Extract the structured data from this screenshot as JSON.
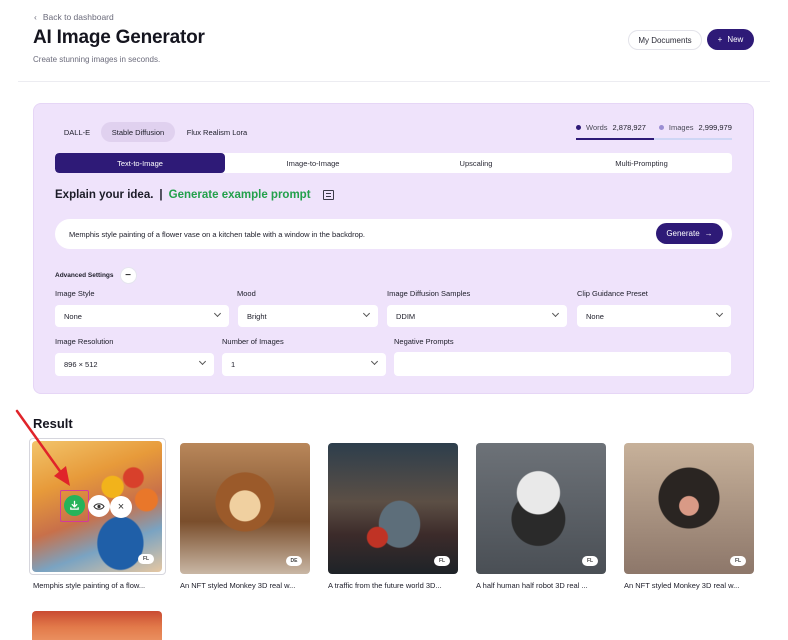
{
  "header": {
    "back_label": "Back to dashboard",
    "title": "AI Image Generator",
    "subtitle": "Create stunning images in seconds.",
    "my_documents_label": "My Documents",
    "new_label": "New"
  },
  "models": [
    "DALL-E",
    "Stable Diffusion",
    "Flux Realism Lora"
  ],
  "active_model": "Stable Diffusion",
  "stats": {
    "words_label": "Words",
    "words_value": "2,878,927",
    "images_label": "Images",
    "images_value": "2,999,979",
    "progress_fraction": 0.5
  },
  "modes": [
    "Text-to-Image",
    "Image-to-Image",
    "Upscaling",
    "Multi-Prompting"
  ],
  "active_mode": "Text-to-Image",
  "explain": {
    "label": "Explain your idea.",
    "separator": "|",
    "example_link": "Generate example prompt"
  },
  "prompt": {
    "value": "Memphis style painting of a flower vase on a kitchen table with a window in the backdrop.",
    "generate_label": "Generate"
  },
  "advanced": {
    "label": "Advanced Settings",
    "toggle_symbol": "−"
  },
  "fields": {
    "image_style": {
      "label": "Image Style",
      "value": "None"
    },
    "mood": {
      "label": "Mood",
      "value": "Bright"
    },
    "diffusion_samples": {
      "label": "Image Diffusion Samples",
      "value": "DDIM"
    },
    "clip_guidance": {
      "label": "Clip Guidance Preset",
      "value": "None"
    },
    "resolution": {
      "label": "Image Resolution",
      "value": "896 × 512"
    },
    "number_of_images": {
      "label": "Number of Images",
      "value": "1"
    },
    "negative_prompts": {
      "label": "Negative Prompts",
      "value": ""
    }
  },
  "result": {
    "title": "Result",
    "items": [
      {
        "caption": "Memphis style painting of a flow...",
        "badge": "FL"
      },
      {
        "caption": "An NFT styled Monkey 3D real w...",
        "badge": "DE"
      },
      {
        "caption": "A traffic from the future world 3D...",
        "badge": "FL"
      },
      {
        "caption": "A half human half robot 3D real ...",
        "badge": "FL"
      },
      {
        "caption": "An NFT styled Monkey 3D real w...",
        "badge": "FL"
      }
    ]
  },
  "colors": {
    "accent": "#2e1a77",
    "panel_bg": "#efe3fb",
    "link_green": "#22a04b",
    "download_green": "#26b35a",
    "highlight_pink": "#d23a9c",
    "annotation_red": "#e0242a"
  },
  "icons": {
    "back": "chevron-left-icon",
    "new": "plus-icon",
    "generate": "arrow-right-icon",
    "list": "list-icon",
    "download": "download-icon",
    "preview": "eye-icon",
    "delete": "close-icon"
  }
}
